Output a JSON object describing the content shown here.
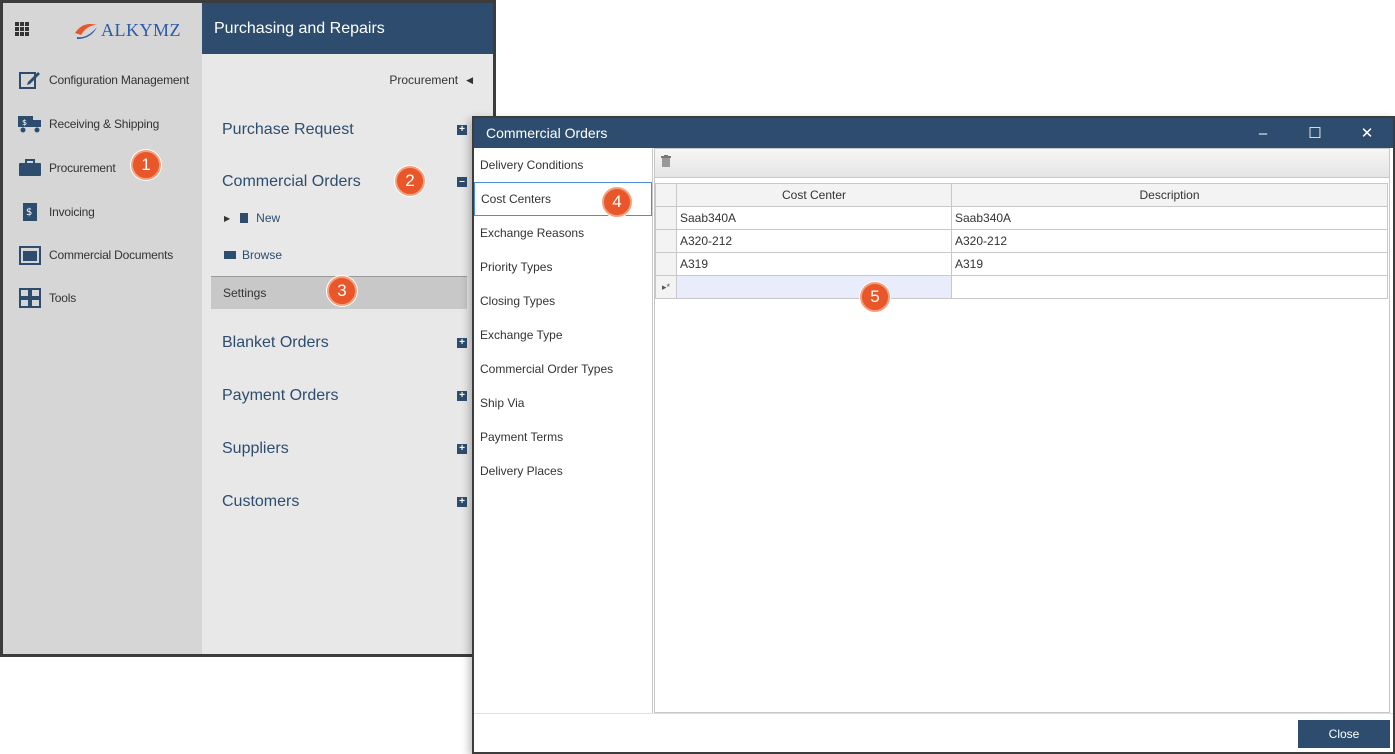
{
  "app": {
    "logo_text": "ALKYMZ",
    "module_title": "Purchasing and Repairs",
    "nav": [
      {
        "label": "Configuration Management",
        "icon": "edit-document-icon"
      },
      {
        "label": "Receiving & Shipping",
        "icon": "truck-icon"
      },
      {
        "label": "Procurement",
        "icon": "briefcase-icon"
      },
      {
        "label": "Invoicing",
        "icon": "invoice-icon"
      },
      {
        "label": "Commercial Documents",
        "icon": "document-folder-icon"
      },
      {
        "label": "Tools",
        "icon": "tools-grid-icon"
      }
    ],
    "breadcrumb": "Procurement",
    "sections": {
      "purchase_request": "Purchase Request",
      "commercial_orders": "Commercial Orders",
      "new": "New",
      "browse": "Browse",
      "settings": "Settings",
      "blanket_orders": "Blanket Orders",
      "payment_orders": "Payment Orders",
      "suppliers": "Suppliers",
      "customers": "Customers"
    }
  },
  "badges": [
    "1",
    "2",
    "3",
    "4",
    "5"
  ],
  "dialog": {
    "title": "Commercial Orders",
    "categories": [
      "Delivery Conditions",
      "Cost Centers",
      "Exchange Reasons",
      "Priority Types",
      "Closing Types",
      "Exchange Type",
      "Commercial Order Types",
      "Ship Via",
      "Payment Terms",
      "Delivery Places"
    ],
    "selected_category": "Cost Centers",
    "grid": {
      "columns": [
        "Cost Center",
        "Description"
      ],
      "rows": [
        [
          "Saab340A",
          "Saab340A"
        ],
        [
          "A320-212",
          "A320-212"
        ],
        [
          "A319",
          "A319"
        ]
      ],
      "new_row_marker": "▸*"
    },
    "close_label": "Close"
  },
  "colors": {
    "header_blue": "#2e4d6e",
    "badge_orange": "#e8562a"
  }
}
